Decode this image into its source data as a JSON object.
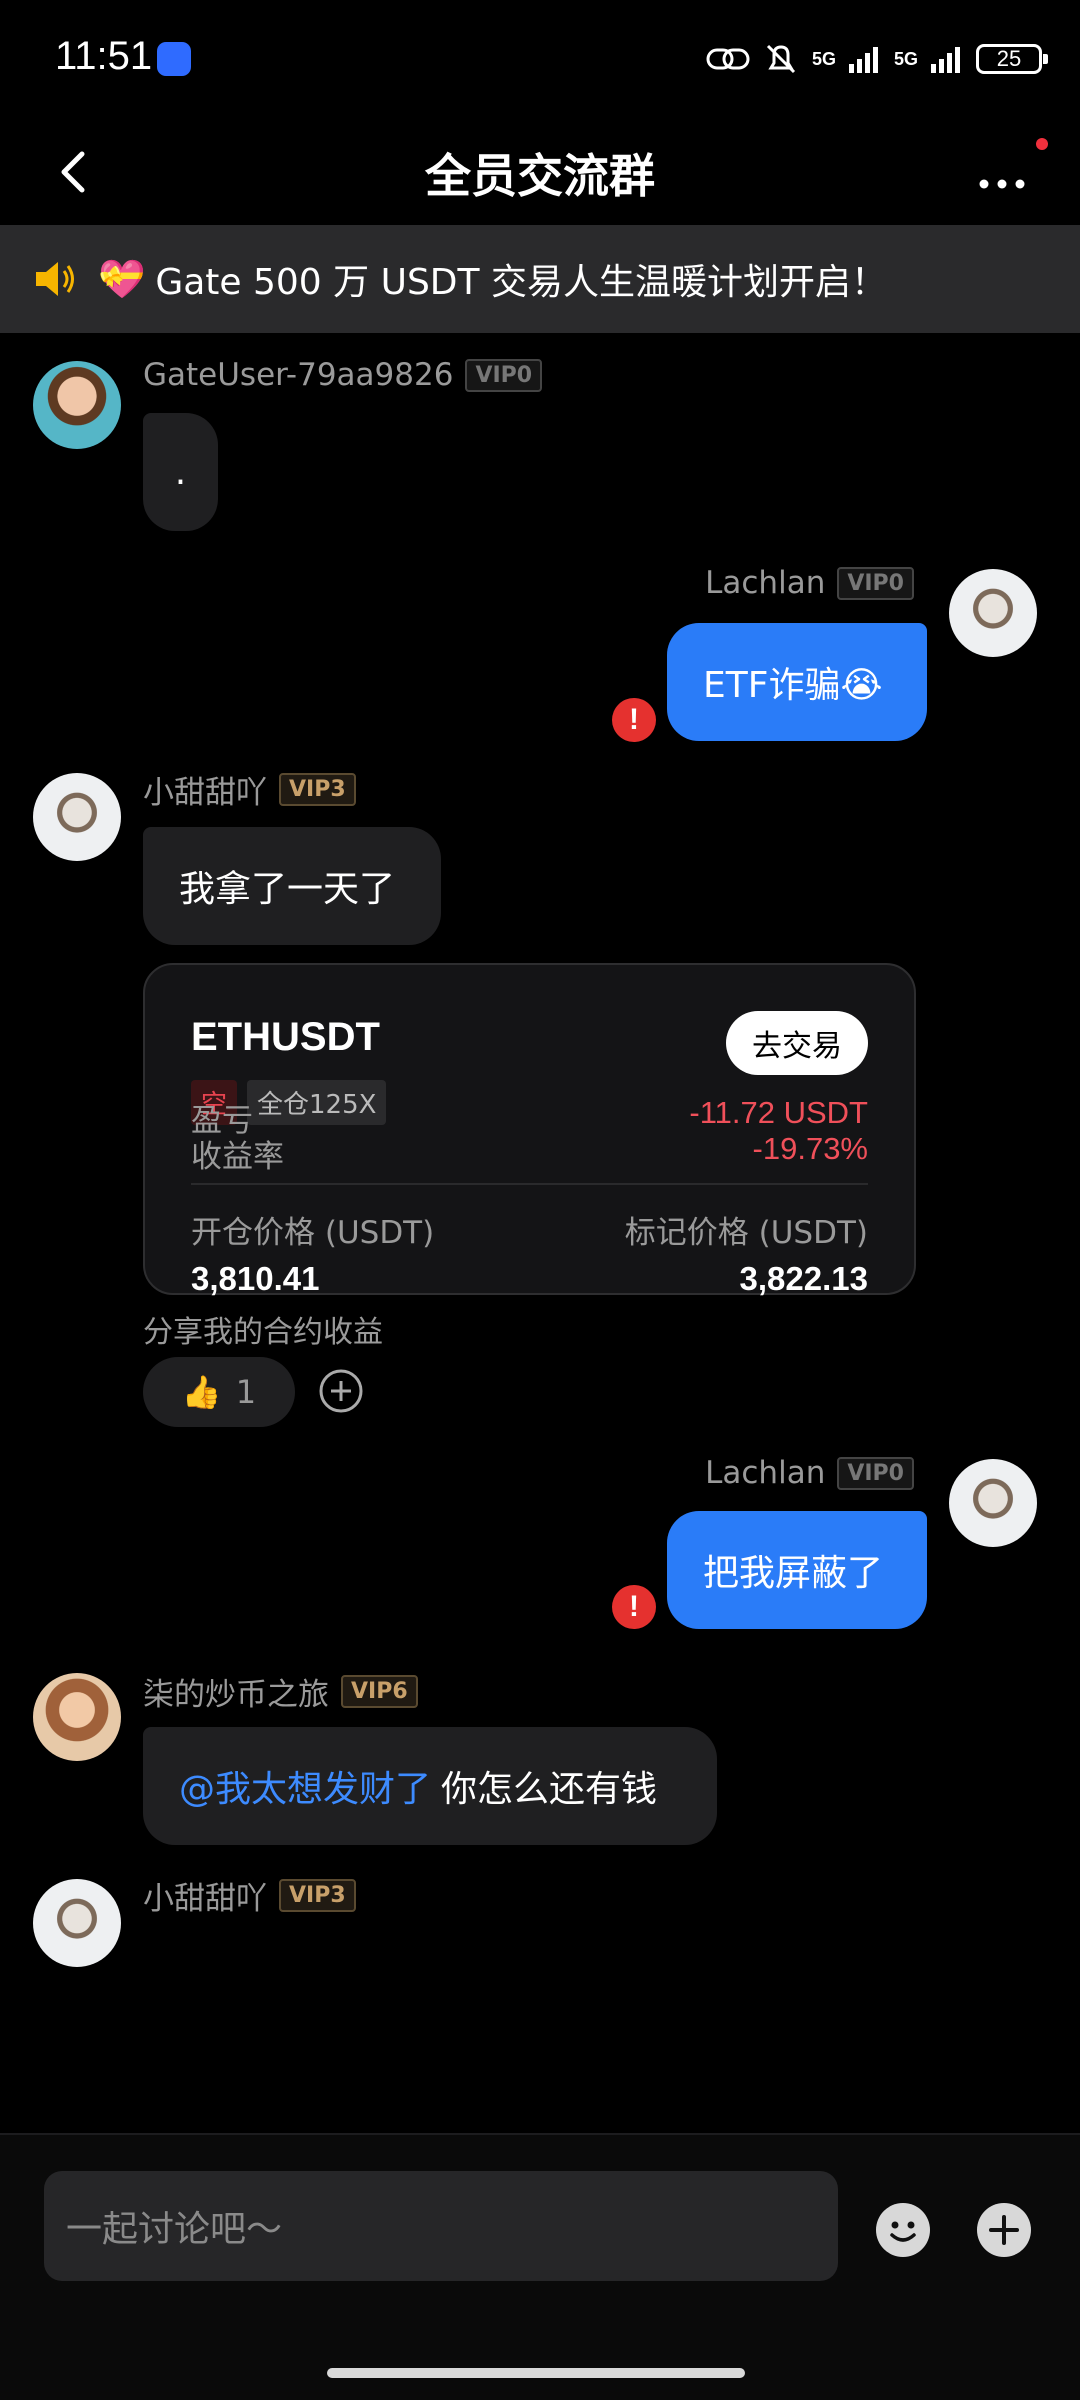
{
  "status_bar": {
    "time": "11:51",
    "battery": "25",
    "network_1": "5G",
    "network_2": "5G"
  },
  "header": {
    "title": "全员交流群"
  },
  "notice": {
    "text": "Gate  500 万 USDT 交易人生温暖计划开启！"
  },
  "messages": [
    {
      "user": "GateUser-79aa9826",
      "vip": "VIP0",
      "text": "."
    },
    {
      "user": "Lachlan",
      "vip": "VIP0",
      "text": "ETF诈骗😭"
    },
    {
      "user": "小甜甜吖",
      "vip": "VIP3",
      "text": "我拿了一天了"
    },
    {
      "user": "Lachlan",
      "vip": "VIP0",
      "text": "把我屏蔽了"
    },
    {
      "user": "柒的炒币之旅",
      "vip": "VIP6",
      "mention": "@我太想发财了",
      "text": "你怎么还有钱"
    },
    {
      "user": "小甜甜吖",
      "vip": "VIP3"
    }
  ],
  "trade_card": {
    "symbol": "ETHUSDT",
    "button": "去交易",
    "side": "空",
    "leverage": "全仓125X",
    "pnl_label": "盈亏",
    "pnl_value": "-11.72 USDT",
    "roe_label": "收益率",
    "roe_value": "-19.73%",
    "entry_label": "开仓价格 (USDT)",
    "entry_value": "3,810.41",
    "mark_label": "标记价格 (USDT)",
    "mark_value": "3,822.13"
  },
  "share_caption": "分享我的合约收益",
  "reaction": {
    "emoji": "👍",
    "count": "1"
  },
  "composer": {
    "placeholder": "一起讨论吧～"
  },
  "colors": {
    "accent_blue": "#2a7cf8",
    "loss_red": "#f0505a",
    "error_red": "#e5312f"
  }
}
